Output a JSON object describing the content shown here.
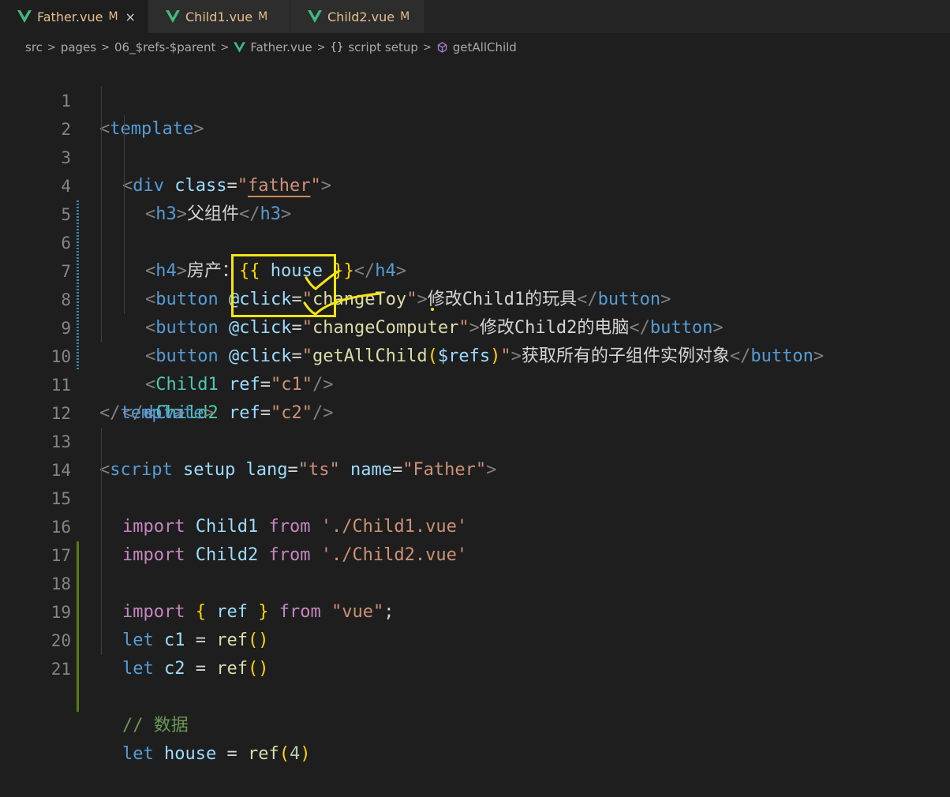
{
  "tabs": [
    {
      "label": "Father.vue",
      "status": "M",
      "active": true,
      "close": "×"
    },
    {
      "label": "Child1.vue",
      "status": "M",
      "active": false
    },
    {
      "label": "Child2.vue",
      "status": "M",
      "active": false
    }
  ],
  "breadcrumb": {
    "items": [
      "src",
      "pages",
      "06_$refs-$parent",
      "Father.vue",
      "script setup",
      "getAllChild"
    ],
    "braces": "{}",
    "separator": ">"
  },
  "editor": {
    "lines": [
      {
        "n": "1"
      },
      {
        "n": "2"
      },
      {
        "n": "3"
      },
      {
        "n": "4"
      },
      {
        "n": "5"
      },
      {
        "n": "6"
      },
      {
        "n": "7"
      },
      {
        "n": "8"
      },
      {
        "n": "9"
      },
      {
        "n": "10"
      },
      {
        "n": "11"
      },
      {
        "n": "12"
      },
      {
        "n": "13"
      },
      {
        "n": "14"
      },
      {
        "n": "15"
      },
      {
        "n": "16"
      },
      {
        "n": "17"
      },
      {
        "n": "18"
      },
      {
        "n": "19"
      },
      {
        "n": "20"
      },
      {
        "n": "21"
      }
    ],
    "code": {
      "l1_tag": "template",
      "l2_tag": "div",
      "l2_attr": "class",
      "l2_val": "father",
      "l3_tag": "h3",
      "l3_text": "父组件",
      "l4_tag": "h4",
      "l4_text": "房产：",
      "l4_expr": "house",
      "l5_tag": "button",
      "l5_attr": "@click",
      "l5_val": "changeToy",
      "l5_text": "修改Child1的玩具",
      "l6_tag": "button",
      "l6_attr": "@click",
      "l6_val": "changeComputer",
      "l6_text": "修改Child2的电脑",
      "l7_tag": "button",
      "l7_attr": "@click",
      "l7_fn": "getAllChild",
      "l7_arg": "$refs",
      "l7_text": "获取所有的子组件实例对象",
      "l8_tag": "Child1",
      "l8_attr": "ref",
      "l8_val": "c1",
      "l9_tag": "Child2",
      "l9_attr": "ref",
      "l9_val": "c2",
      "l10_tag": "div",
      "l11_tag": "template",
      "l13_tag": "script",
      "l13_a1": "setup",
      "l13_a2": "lang",
      "l13_v2": "ts",
      "l13_a3": "name",
      "l13_v3": "Father",
      "l14_kw": "import",
      "l14_id": "Child1",
      "l14_from": "from",
      "l14_path": "'./Child1.vue'",
      "l15_kw": "import",
      "l15_id": "Child2",
      "l15_from": "from",
      "l15_path": "'./Child2.vue'",
      "l16_kw": "import",
      "l16_id": "ref",
      "l16_from": "from",
      "l16_path": "\"vue\"",
      "l17_kw": "let",
      "l17_var": "c1",
      "l17_fn": "ref",
      "l18_kw": "let",
      "l18_var": "c2",
      "l18_fn": "ref",
      "l20_comment": "// 数据",
      "l21_kw": "let",
      "l21_var": "house",
      "l21_fn": "ref",
      "l21_num": "4"
    }
  },
  "colors": {
    "editor_bg": "#1e1e1e",
    "annotation": "#f5e513",
    "tab_modified": "#e2c08d",
    "vue_green": "#41b883"
  }
}
